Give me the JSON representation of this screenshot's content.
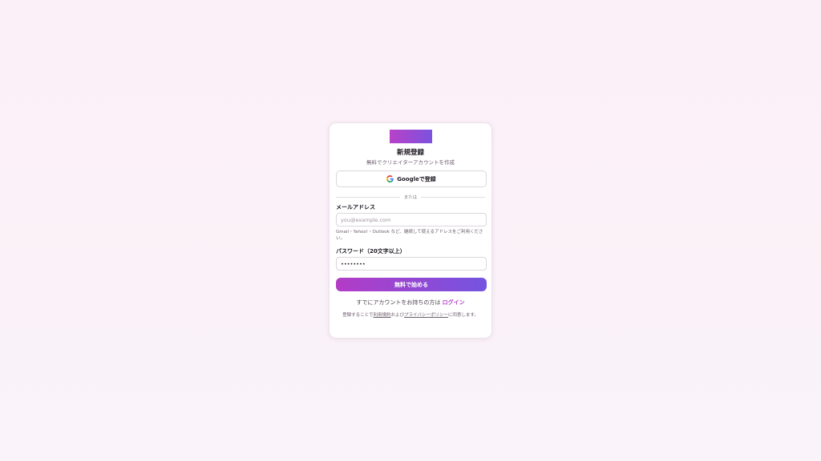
{
  "colors": {
    "accent_start": "#b33cc6",
    "accent_end": "#7454e0",
    "page_background": "#fbf0f8"
  },
  "card": {
    "logo_icon": "brand-logo-gradient-block",
    "title": "新規登録",
    "subtitle": "無料でクリエイターアカウントを作成",
    "google_button_label": "Googleで登録",
    "google_icon": "google-g-icon",
    "divider_text": "または",
    "email": {
      "label": "メールアドレス",
      "placeholder": "you@example.com",
      "value": "",
      "hint": "Gmail・Yahoo!・Outlook など、継続して使えるアドレスをご利用ください。"
    },
    "password": {
      "label": "パスワード（20文字以上）",
      "value": "••••••••"
    },
    "submit_label": "無料で始める",
    "login_prompt": "すでにアカウントをお持ちの方は",
    "login_link": "ログイン",
    "terms": {
      "prefix": "登録することで",
      "terms_link": "利用規約",
      "middle": "および",
      "privacy_link": "プライバシーポリシー",
      "suffix": "に同意します。"
    }
  }
}
